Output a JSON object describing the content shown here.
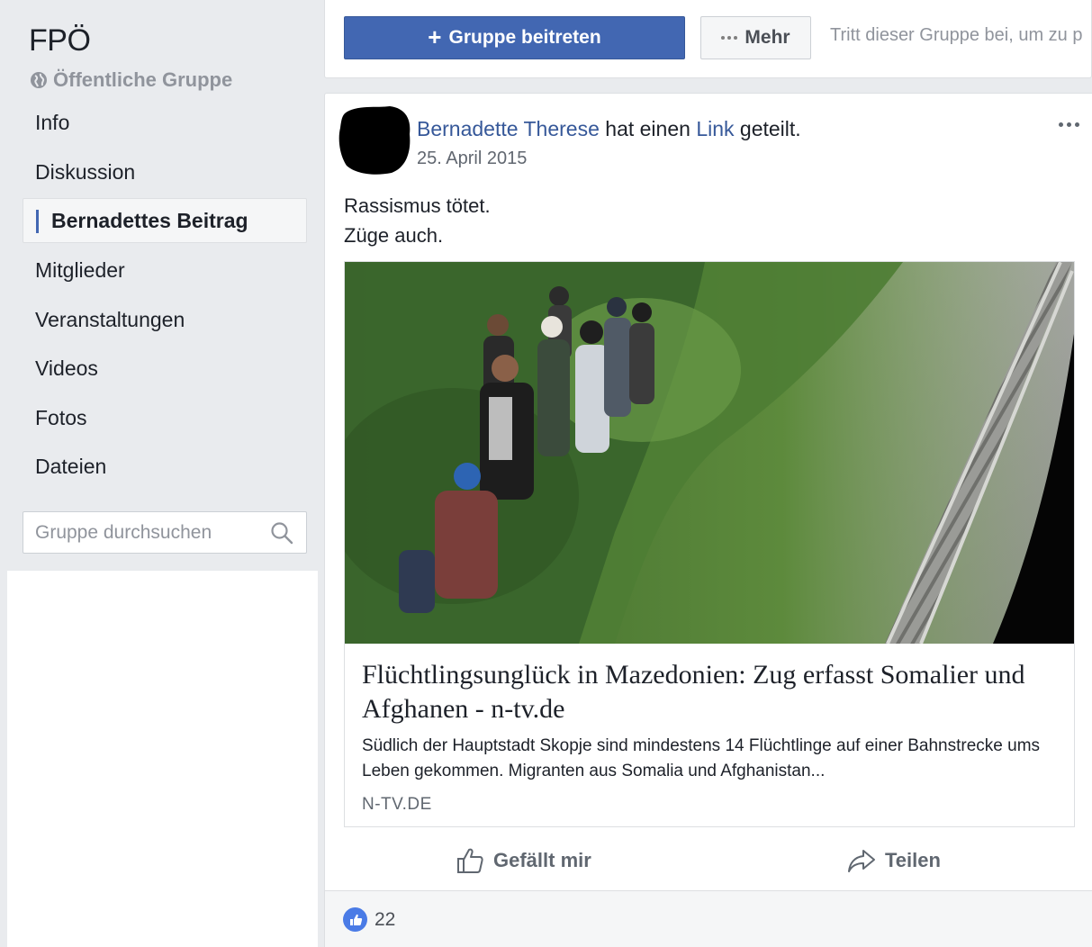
{
  "group": {
    "name": "FPÖ",
    "privacy": "Öffentliche Gruppe"
  },
  "sidebar": {
    "items": [
      {
        "label": "Info"
      },
      {
        "label": "Diskussion"
      },
      {
        "label": "Bernadettes Beitrag",
        "active": true
      },
      {
        "label": "Mitglieder"
      },
      {
        "label": "Veranstaltungen"
      },
      {
        "label": "Videos"
      },
      {
        "label": "Fotos"
      },
      {
        "label": "Dateien"
      }
    ],
    "search_placeholder": "Gruppe durchsuchen"
  },
  "topbar": {
    "join_label": "Gruppe beitreten",
    "more_label": "Mehr",
    "hint": "Tritt dieser Gruppe bei, um zu p"
  },
  "post": {
    "author": "Bernadette Therese",
    "action_prefix": "hat einen",
    "action_link": "Link",
    "action_suffix": "geteilt.",
    "date": "25. April 2015",
    "text_line1": "Rassismus tötet.",
    "text_line2": "Züge auch.",
    "link": {
      "title": "Flüchtlingsunglück in Mazedonien: Zug erfasst Somalier und Afghanen - n-tv.de",
      "description": "Südlich der Hauptstadt Skopje sind mindestens 14 Flüchtlinge auf einer Bahnstrecke ums Leben gekommen. Migranten aus Somalia und Afghanistan...",
      "domain": "N-TV.DE"
    },
    "like_label": "Gefällt mir",
    "share_label": "Teilen",
    "like_count": "22"
  },
  "colors": {
    "brand_blue": "#4267b2",
    "link_blue": "#365899",
    "page_bg": "#e9ebee"
  }
}
